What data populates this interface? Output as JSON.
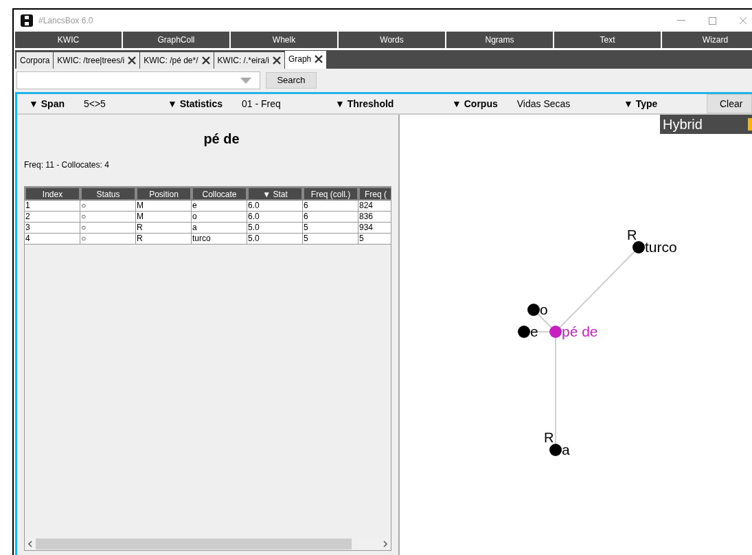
{
  "window": {
    "title": "#LancsBox 6.0"
  },
  "nav_buttons": [
    "KWIC",
    "GraphColl",
    "Whelk",
    "Words",
    "Ngrams",
    "Text",
    "Wizard"
  ],
  "tabs": [
    {
      "label": "Corpora",
      "selected": false,
      "closable": false
    },
    {
      "label": "KWIC: /tree|trees/i",
      "selected": false,
      "closable": true
    },
    {
      "label": "KWIC: /pé de*/",
      "selected": false,
      "closable": true
    },
    {
      "label": "KWIC: /.*eira/i",
      "selected": false,
      "closable": true
    },
    {
      "label": "Graph",
      "selected": true,
      "closable": true
    }
  ],
  "search": {
    "button": "Search"
  },
  "filters": [
    {
      "label": "▼ Span",
      "value": "5<>5"
    },
    {
      "label": "▼ Statistics",
      "value": "01 - Freq"
    },
    {
      "label": "▼ Threshold"
    },
    {
      "label": "▼ Corpus",
      "value": "Vidas Secas"
    },
    {
      "label": "▼ Type"
    }
  ],
  "clear_button": "Clear",
  "results": {
    "title": "pé de",
    "summary": "Freq: 11 - Collocates: 4",
    "table": {
      "columns": [
        "Index",
        "Status",
        "Position",
        "Collocate",
        "▼ Stat",
        "Freq (coll.)",
        "Freq ("
      ],
      "rows": [
        [
          "1",
          "○",
          "M",
          "e",
          "6.0",
          "6",
          "824"
        ],
        [
          "2",
          "○",
          "M",
          "o",
          "6.0",
          "6",
          "836"
        ],
        [
          "3",
          "○",
          "R",
          "a",
          "5.0",
          "5",
          "934"
        ],
        [
          "4",
          "○",
          "R",
          "turco",
          "5.0",
          "5",
          "5"
        ]
      ]
    }
  },
  "graph": {
    "legend": "Hybrid",
    "nodes": [
      {
        "label": "pé de",
        "kind": "center"
      },
      {
        "label": "e",
        "kind": "collocate"
      },
      {
        "label": "o",
        "kind": "collocate"
      },
      {
        "label": "turco",
        "kind": "collocate",
        "position": "R"
      },
      {
        "label": "a",
        "kind": "collocate",
        "position": "R"
      }
    ]
  }
}
